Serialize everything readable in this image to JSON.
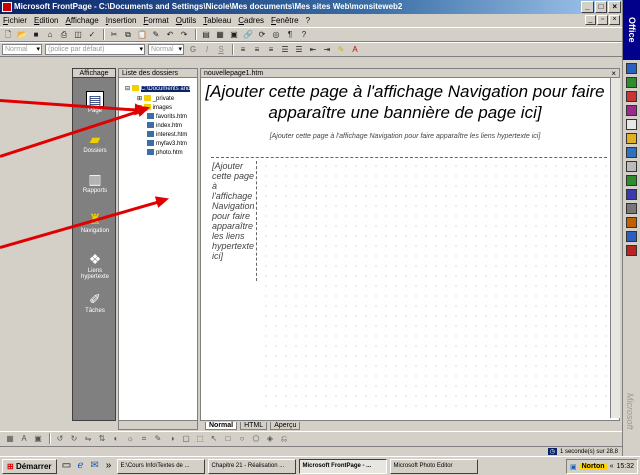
{
  "window": {
    "title": "Microsoft FrontPage - C:\\Documents and Settings\\Nicole\\Mes documents\\Mes sites Web\\monsiteweb2",
    "controls": [
      "_",
      "□",
      "×"
    ]
  },
  "menu": {
    "items": [
      "Fichier",
      "Edition",
      "Affichage",
      "Insertion",
      "Format",
      "Outils",
      "Tableau",
      "Cadres",
      "Fenêtre",
      "?"
    ]
  },
  "format_toolbar": {
    "style_value": "Normal",
    "font_value": "(police par défaut)",
    "size_value": "Normal"
  },
  "views_panel": {
    "header": "Affichage",
    "items": [
      {
        "label": "Page",
        "icon": "page-icon",
        "selected": true
      },
      {
        "label": "Dossiers",
        "icon": "folders-icon",
        "selected": false
      },
      {
        "label": "Rapports",
        "icon": "reports-icon",
        "selected": false
      },
      {
        "label": "Navigation",
        "icon": "navigation-icon",
        "selected": false
      },
      {
        "label": "Liens hypertexte",
        "icon": "hyperlinks-icon",
        "selected": false
      },
      {
        "label": "Tâches",
        "icon": "tasks-icon",
        "selected": false
      }
    ]
  },
  "folder_list": {
    "header": "Liste des dossiers",
    "root": "C:\\Documents and",
    "items": [
      "_private",
      "images",
      "favorits.htm",
      "index.htm",
      "interest.htm",
      "myfav3.htm",
      "photo.htm"
    ]
  },
  "editor": {
    "tab_label": "nouvellepage1.htm",
    "banner_placeholder": "[Ajouter cette page à l'affichage Navigation pour faire apparaître une bannière de page ici]",
    "nav_links_placeholder": "[Ajouter cette page à l'affichage Navigation pour faire apparaître les liens hypertexte ici]",
    "left_links_placeholder": "[Ajouter cette page à l'affichage Navigation pour faire apparaître les liens hypertexte ici]"
  },
  "view_tabs": [
    "Normal",
    "HTML",
    "Aperçu"
  ],
  "status": {
    "time_estimate": "1 seconde(s) sur 28,8"
  },
  "office_bar": {
    "label": "Office",
    "brand": "Microsoft"
  },
  "taskbar": {
    "start": "Démarrer",
    "tasks": [
      {
        "label": "E:\\Cours Info\\Textes de ...",
        "active": false
      },
      {
        "label": "Chapitre 21 - Réalisation ...",
        "active": false
      },
      {
        "label": "Microsoft FrontPage - ...",
        "active": true
      },
      {
        "label": "Microsoft Photo Editor",
        "active": false
      }
    ],
    "tray_app": "Norton",
    "clock": "15:32"
  },
  "colors": {
    "arrow": "#e00000",
    "titlebar": "#0a246a",
    "chrome": "#d4d0c8"
  }
}
